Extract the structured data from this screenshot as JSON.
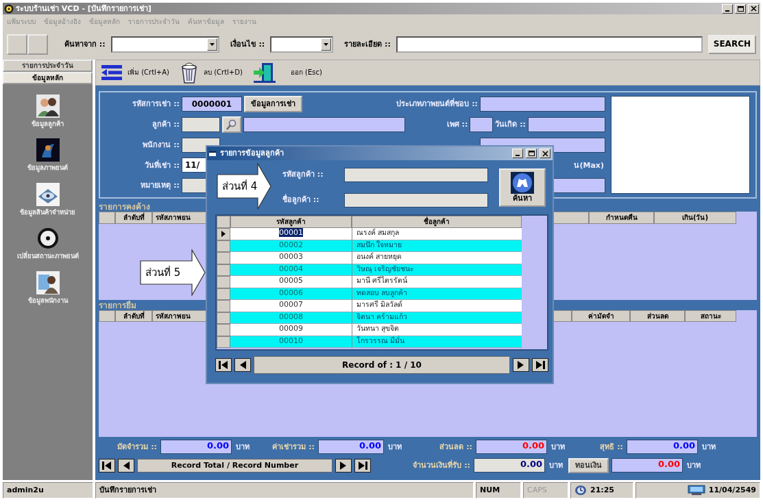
{
  "window": {
    "title": "ระบบร้านเช่า VCD - [บันทึกรายการเช่า]"
  },
  "menu": [
    {
      "label": "แฟ้มระบบ"
    },
    {
      "label": "ข้อมูลอ้างอิง"
    },
    {
      "label": "ข้อมูลหลัก"
    },
    {
      "label": "รายการประจำวัน"
    },
    {
      "label": "ค้นหาข้อมูล"
    },
    {
      "label": "รายงาน"
    }
  ],
  "search_bar": {
    "from_label": "ค้นหาจาก ::",
    "condition_label": "เงื่อนไข ::",
    "detail_label": "รายละเอียด ::",
    "button": "SEARCH"
  },
  "sidebar": {
    "tabs": [
      {
        "label": "รายการประจำวัน",
        "selected": false
      },
      {
        "label": "ข้อมูลหลัก",
        "selected": true
      }
    ],
    "items": [
      {
        "kind": "customers",
        "label": "ข้อมูลลูกค้า"
      },
      {
        "kind": "movies",
        "label": "ข้อมูลภาพยนต์"
      },
      {
        "kind": "products",
        "label": "ข้อมูลสินค้าจำหน่าย"
      },
      {
        "kind": "disc",
        "label": "เปลี่ยนสถานะภาพยนต์"
      },
      {
        "kind": "employees",
        "label": "ข้อมูลพนักงาน"
      }
    ]
  },
  "toolbar": [
    {
      "kind": "add",
      "label": "เพิ่ม (Crtl+A)"
    },
    {
      "kind": "delete",
      "label": "ลบ (Crtl+D)"
    },
    {
      "kind": "exit",
      "label": "ออก (Esc)"
    }
  ],
  "rental_form": {
    "rental_id_label": "รหัสการเช่า ::",
    "rental_id": "0000001",
    "rental_info_button": "ข้อมูลการเช่า",
    "customer_label": "ลูกค้า ::",
    "employee_label": "พนักงาน ::",
    "rent_date_label": "วันที่เช่า ::",
    "rent_date": "11/",
    "note_label": "หมายเหตุ ::",
    "favorite_type_label": "ประเภทภาพยนต์ที่ชอบ ::",
    "gender_label": "เพศ ::",
    "birth_date_label": "วันเกิด ::",
    "max_label": "น(Max)"
  },
  "outstanding": {
    "title": "รายการคงค้าง",
    "leading_columns": [
      "ลำดับที่",
      "รหัสภาพยน"
    ],
    "trailing_columns": [
      "กำหนดคืน",
      "เกิน(วัน)"
    ]
  },
  "borrowed": {
    "title": "รายการยืม",
    "leading_columns": [
      "ลำดับที่",
      "รหัสภาพยน"
    ],
    "trailing_columns": [
      "ค่ามัดจำ",
      "ส่วนลด",
      "สถานะ"
    ]
  },
  "totals_row": [
    {
      "label": "มัดจำรวม ::",
      "value": "0.00",
      "unit": "บาท",
      "color": "#0000ff"
    },
    {
      "label": "ค่าเช่ารวม ::",
      "value": "0.00",
      "unit": "บาท",
      "color": "#0000ff"
    },
    {
      "label": "ส่วนลด ::",
      "value": "0.00",
      "unit": "บาท",
      "color": "#ff0000"
    },
    {
      "label": "สุทธิ ::",
      "value": "0.00",
      "unit": "บาท",
      "color": "#0000ff"
    }
  ],
  "record_nav": {
    "label": "Record Total / Record Number"
  },
  "payment_row": [
    {
      "kind": "field",
      "label": "จำนวนเงินที่รับ ::",
      "value": "0.00",
      "unit": "บาท",
      "color": "#000080"
    },
    {
      "kind": "button",
      "label": "ทอนเงิน"
    },
    {
      "kind": "field",
      "value": "0.00",
      "unit": "บาท",
      "color": "#ff0000"
    }
  ],
  "status_bar": [
    {
      "kind": "text",
      "text": "admin2u"
    },
    {
      "kind": "text",
      "text": "บันทึกรายการเช่า"
    },
    {
      "kind": "key",
      "text": "NUM",
      "on": true
    },
    {
      "kind": "key",
      "text": "CAPS",
      "on": false
    },
    {
      "kind": "time",
      "text": "21:25"
    },
    {
      "kind": "date",
      "text": "11/04/2549"
    }
  ],
  "popup": {
    "title": "รายการข้อมูลลูกค้า",
    "code_label": "รหัสลูกค้า ::",
    "name_label": "ชื่อลูกค้า ::",
    "search_button": "ค้นหา",
    "columns": [
      "รหัสลูกค้า",
      "ชื่อลูกค้า"
    ],
    "rows": [
      {
        "code": "00001",
        "name": "ณรงค์ สมสกุล",
        "selected": true
      },
      {
        "code": "00002",
        "name": "สมนึก ใจหมาย",
        "selected": false
      },
      {
        "code": "00003",
        "name": "อนงค์ สายหยุด",
        "selected": false
      },
      {
        "code": "00004",
        "name": "วิษณุ เจริญชัยชนะ",
        "selected": false
      },
      {
        "code": "00005",
        "name": "มานี ศรีไตรรัตน์",
        "selected": false
      },
      {
        "code": "00006",
        "name": "ทดสอบ ลบลูกค้า",
        "selected": false
      },
      {
        "code": "00007",
        "name": "มารศรี มิลวัลด์",
        "selected": false
      },
      {
        "code": "00008",
        "name": "จิตนา คร้ามแก้ว",
        "selected": false
      },
      {
        "code": "00009",
        "name": "วันทนา สุขจิต",
        "selected": false
      },
      {
        "code": "00010",
        "name": "โกรวรรณ มีมั่น",
        "selected": false
      }
    ],
    "record_label": "Record of : 1 / 10"
  },
  "callouts": [
    {
      "label": "ส่วนที่ 4"
    },
    {
      "label": "ส่วนที่ 5"
    }
  ]
}
